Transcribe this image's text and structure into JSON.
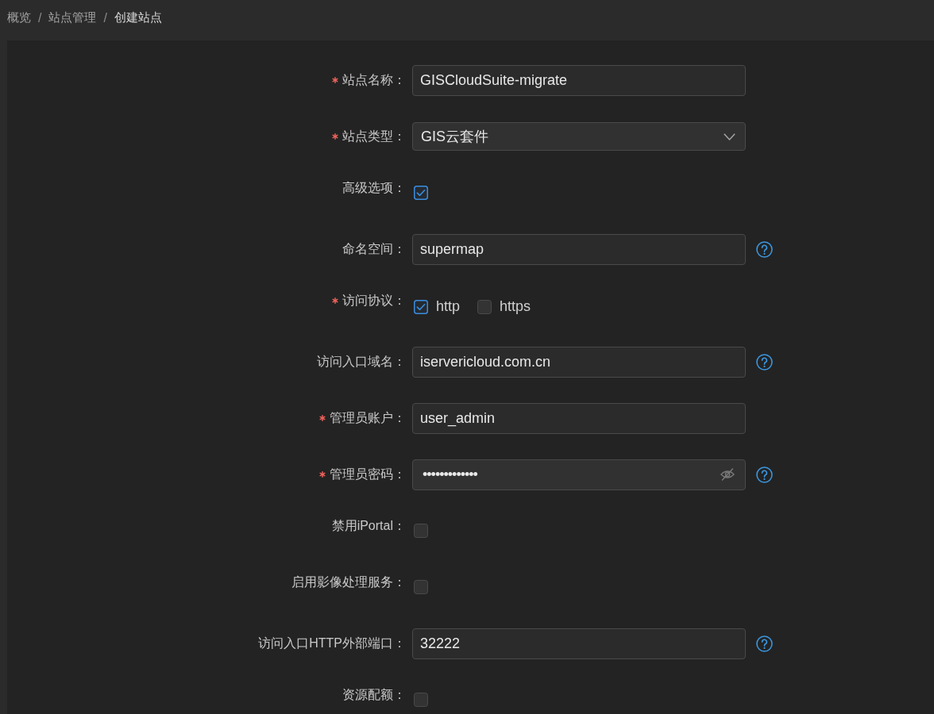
{
  "breadcrumb": [
    {
      "label": "概览",
      "separator": "/"
    },
    {
      "label": "站点管理",
      "separator": "/"
    },
    {
      "label": "创建站点"
    }
  ],
  "form": {
    "fields": [
      {
        "kind": "text",
        "label": "站点名称：",
        "required": true,
        "value": "GISCloudSuite-migrate",
        "help": false
      },
      {
        "kind": "select",
        "label": "站点类型：",
        "required": true,
        "value": "GIS云套件",
        "help": false
      },
      {
        "kind": "checkbox",
        "label": "高级选项：",
        "required": false,
        "checked": true,
        "help": false
      },
      {
        "kind": "text",
        "label": "命名空间：",
        "required": false,
        "value": "supermap",
        "help": true
      },
      {
        "kind": "checkbox_group",
        "label": "访问协议：",
        "required": true,
        "help": false,
        "options": [
          {
            "label": "http",
            "checked": true
          },
          {
            "label": "https",
            "checked": false
          }
        ]
      },
      {
        "kind": "text",
        "label": "访问入口域名：",
        "required": false,
        "value": "iservericloud.com.cn",
        "help": true
      },
      {
        "kind": "text",
        "label": "管理员账户：",
        "required": true,
        "value": "user_admin",
        "help": false
      },
      {
        "kind": "password",
        "label": "管理员密码：",
        "required": true,
        "value": "•••••••••••••",
        "revealed": false,
        "help": true
      },
      {
        "kind": "checkbox",
        "label": "禁用iPortal：",
        "required": false,
        "checked": false,
        "help": false
      },
      {
        "kind": "checkbox",
        "label": "启用影像处理服务：",
        "required": false,
        "checked": false,
        "help": false
      },
      {
        "kind": "text",
        "label": "访问入口HTTP外部端口：",
        "required": false,
        "value": "32222",
        "help": true
      },
      {
        "kind": "checkbox",
        "label": "资源配额：",
        "required": false,
        "checked": false,
        "help": false
      }
    ]
  }
}
